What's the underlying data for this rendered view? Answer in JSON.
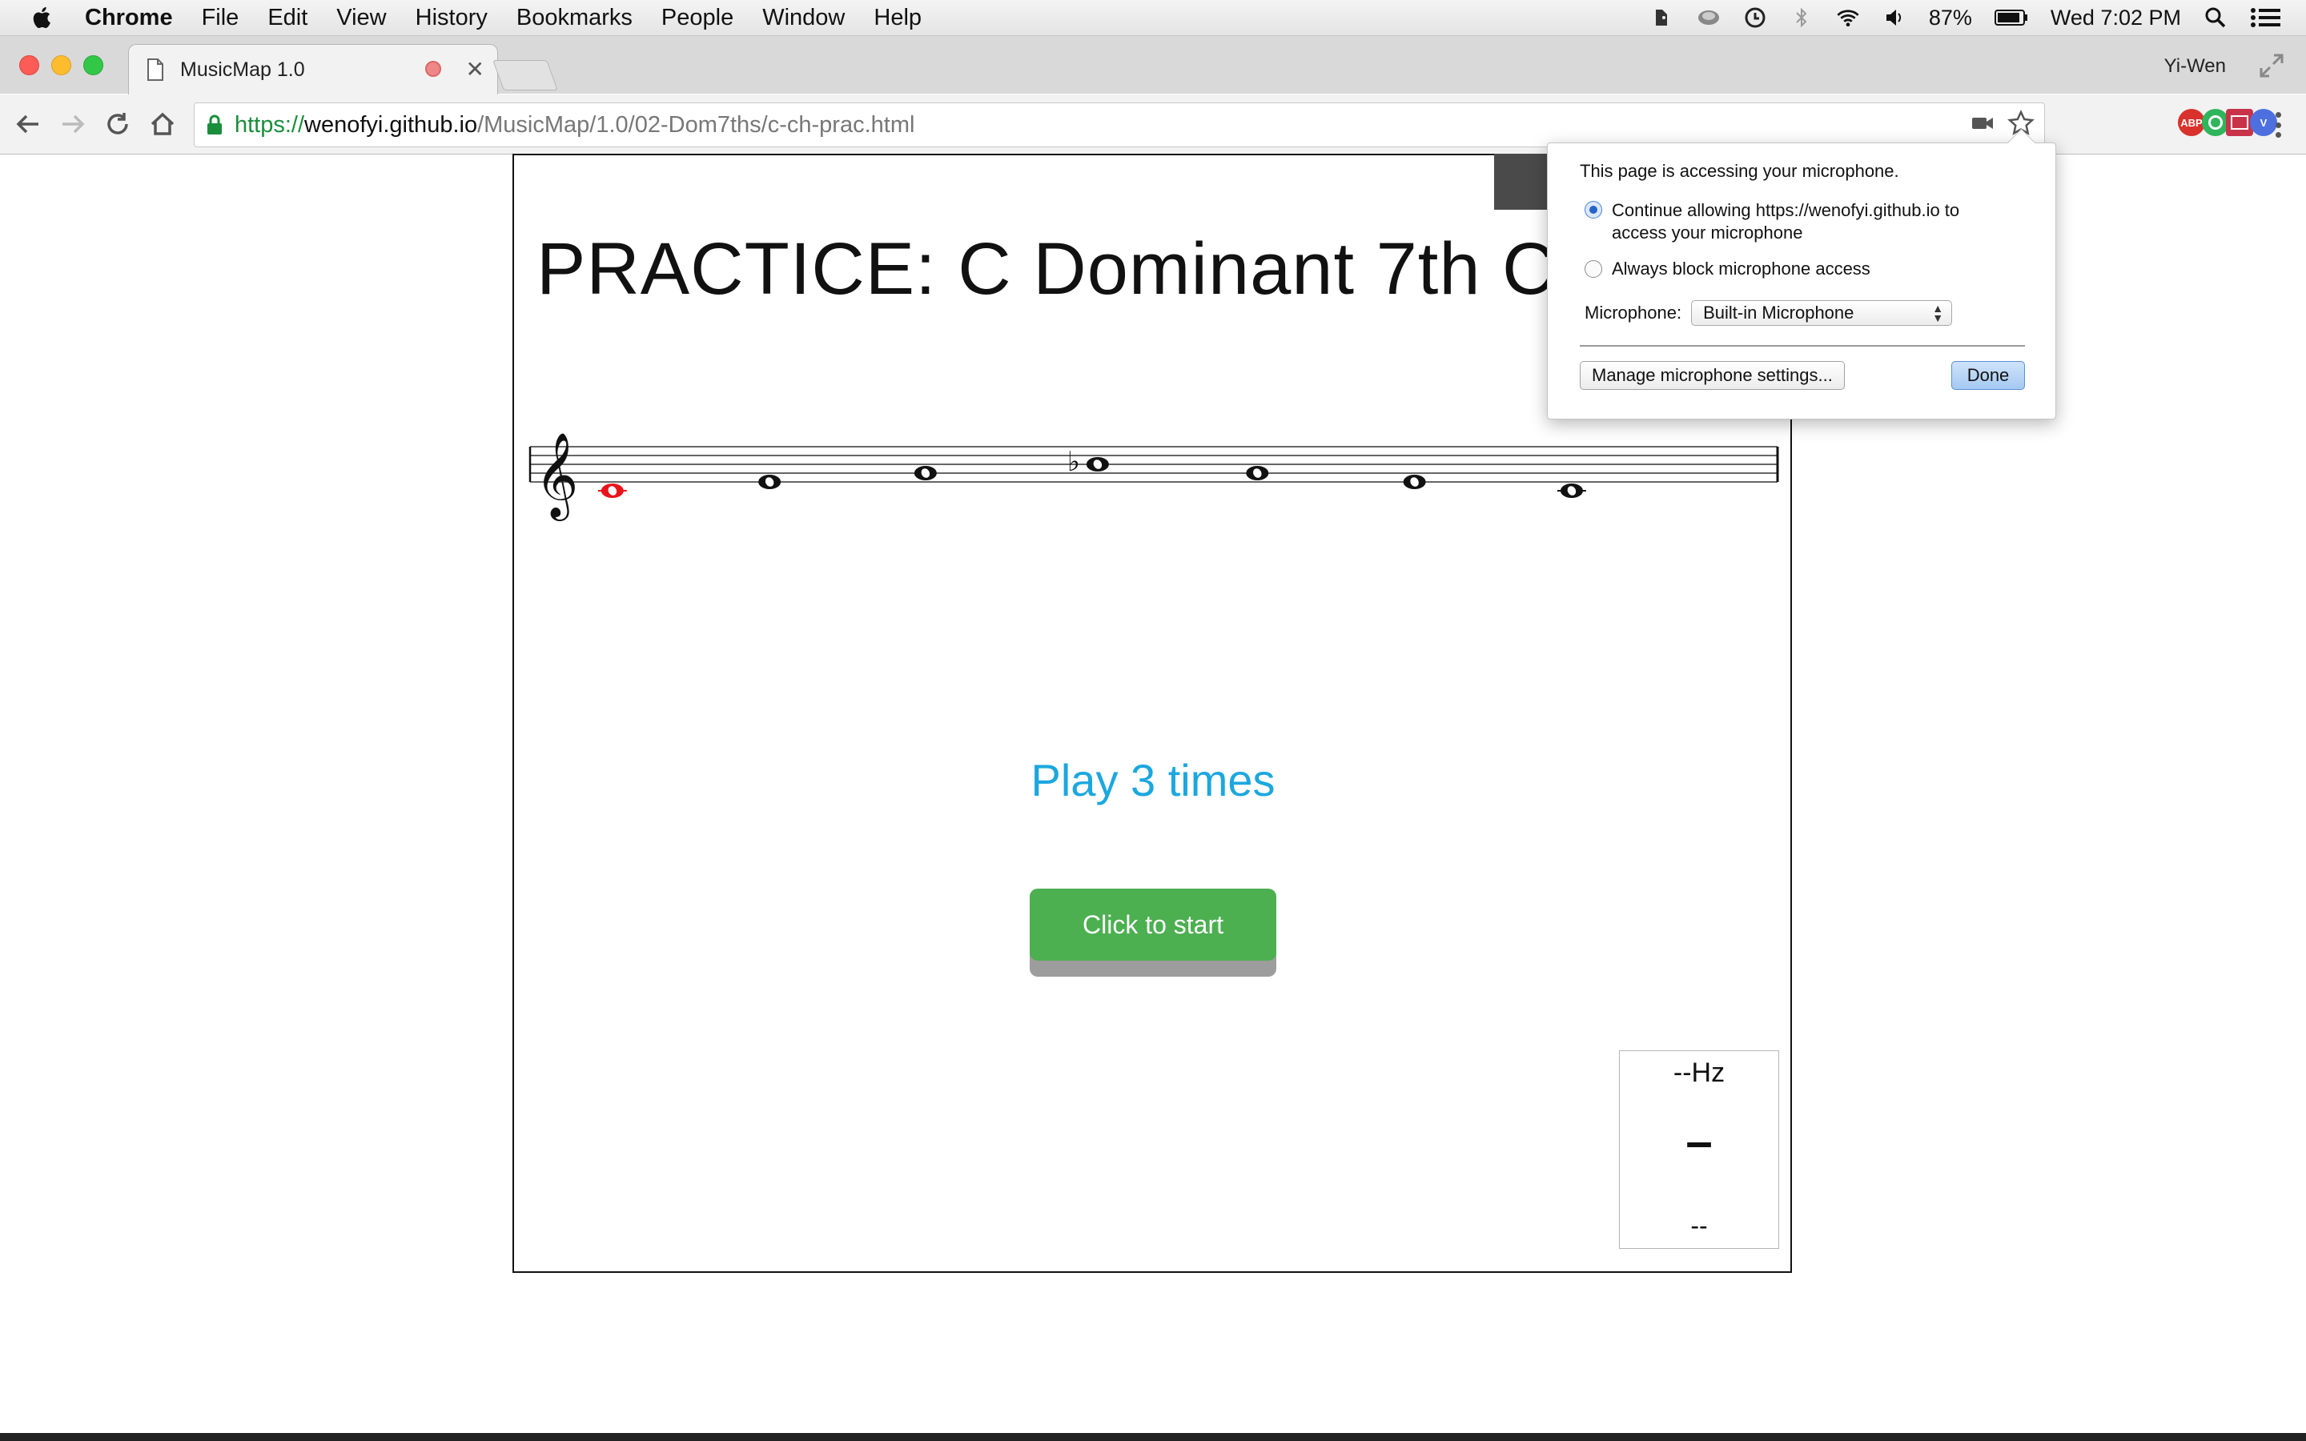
{
  "menubar": {
    "app": "Chrome",
    "items": [
      "File",
      "Edit",
      "View",
      "History",
      "Bookmarks",
      "People",
      "Window",
      "Help"
    ],
    "battery": "87%",
    "clock": "Wed 7:02 PM"
  },
  "tab": {
    "title": "MusicMap 1.0"
  },
  "profile": "Yi-Wen",
  "address": {
    "scheme": "https://",
    "host": "wenofyi.github.io",
    "path": "/MusicMap/1.0/02-Dom7ths/c-ch-prac.html"
  },
  "extensions": [
    {
      "name": "adblock-plus-icon",
      "label": "ABP",
      "color": "#d9312b"
    },
    {
      "name": "green-extension-icon",
      "label": "",
      "color": "#2fb55c"
    },
    {
      "name": "red-extension-icon",
      "label": "",
      "color": "#c8334a"
    },
    {
      "name": "blue-extension-icon",
      "label": "V",
      "color": "#4d6fe0"
    }
  ],
  "page": {
    "title": "PRACTICE: C Dominant 7th Cho",
    "instruction": "Play 3 times",
    "start_button": "Click to start",
    "tuner": {
      "frequency": "--Hz",
      "note": "–",
      "cents": "--"
    }
  },
  "staff": {
    "clef": "treble",
    "notes": [
      "C4",
      "E4",
      "G4",
      "Bb4",
      "G4",
      "E4",
      "C4"
    ],
    "highlighted_index": 0,
    "highlight_color": "#e8141b"
  },
  "permission_popup": {
    "message": "This page is accessing your microphone.",
    "options": [
      {
        "label": "Continue allowing https://wenofyi.github.io to",
        "label2": "access your microphone",
        "selected": true
      },
      {
        "label": "Always block microphone access",
        "selected": false
      }
    ],
    "microphone_label": "Microphone:",
    "microphone_value": "Built-in Microphone",
    "manage_button": "Manage microphone settings...",
    "done_button": "Done"
  },
  "colors": {
    "accent_blue": "#1ca7df",
    "start_green": "#4caf50"
  }
}
